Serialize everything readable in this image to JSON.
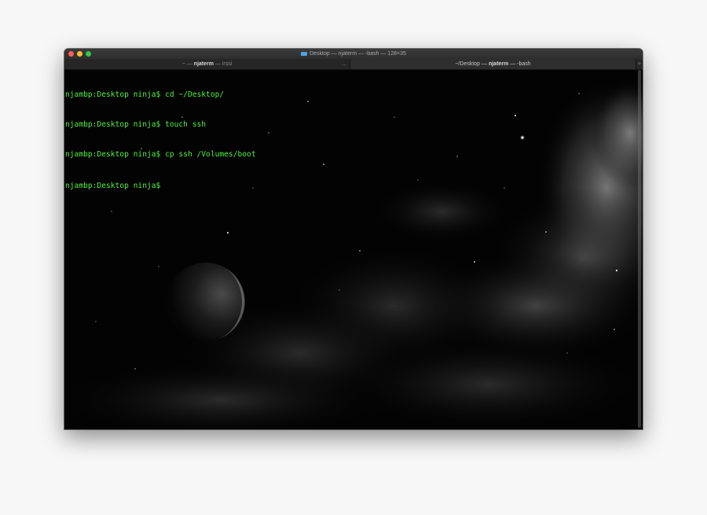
{
  "window": {
    "title": "Desktop — njaterm — -bash — 128×35",
    "folder_icon": "folder-icon"
  },
  "tabs": [
    {
      "label_prefix": "~ — ",
      "label_bold": "njaterm",
      "label_suffix": " — irssi",
      "overflow": "...",
      "active": false
    },
    {
      "label_prefix": "~/Desktop — ",
      "label_bold": "njaterm",
      "label_suffix": " — -bash",
      "active": true
    }
  ],
  "new_tab_label": "+",
  "terminal": {
    "lines": [
      "njambp:Desktop ninja$ cd ~/Desktop/",
      "njambp:Desktop ninja$ touch ssh",
      "njambp:Desktop ninja$ cp ssh /Volumes/boot",
      "njambp:Desktop ninja$ "
    ],
    "text_color": "#4ef03d"
  },
  "colors": {
    "close": "#fc5f57",
    "minimize": "#fdbc2e",
    "maximize": "#33c748"
  }
}
